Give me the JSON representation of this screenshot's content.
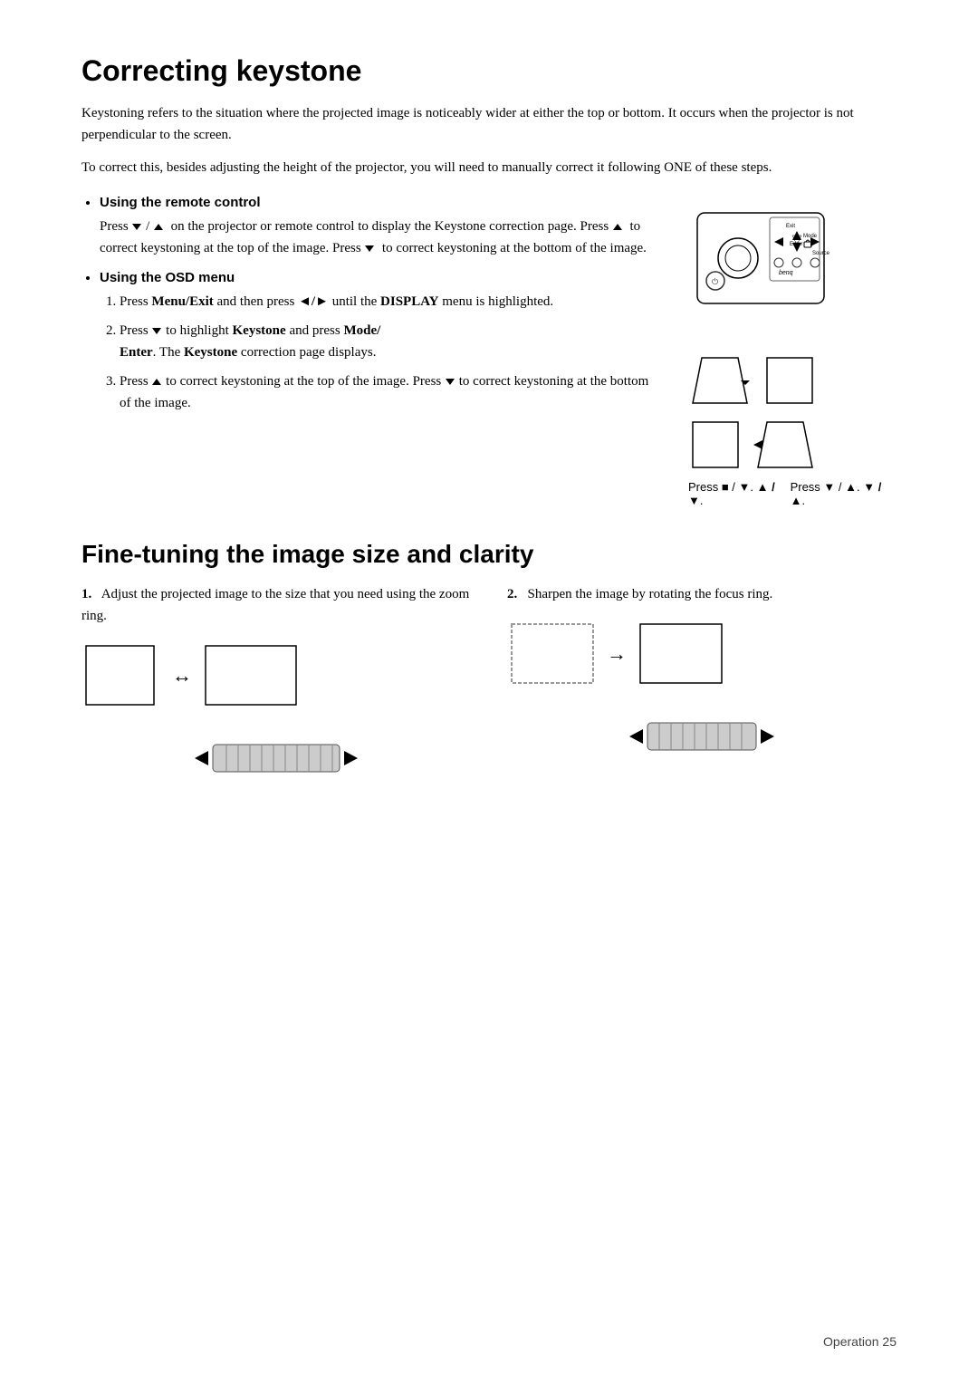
{
  "page": {
    "title": "Correcting keystone",
    "section2_title": "Fine-tuning the image size and clarity",
    "footer": "Operation    25"
  },
  "correcting_keystone": {
    "intro1": "Keystoning refers to the situation where the projected image is noticeably wider at either the top or bottom. It occurs when the projector is not perpendicular to the screen.",
    "intro2": "To correct this, besides adjusting the height of the projector, you will need to manually correct it following ONE of these steps.",
    "bullet1_label": "Using the remote control",
    "bullet1_text1": " /    on the projector or remote control to display the Keystone correction page. Press    to correct keystoning at the top of the image. Press    to correct keystoning at the bottom of the image.",
    "bullet1_press_prefix": "Press",
    "bullet2_label": "Using the OSD menu",
    "step1": "Press Menu/Exit and then press ◄/► until the DISPLAY menu is highlighted.",
    "step2_part1": "Press",
    "step2_part2": "to highlight",
    "step2_keystone": "Keystone",
    "step2_part3": "and press",
    "step2_modeenter": "Mode/Enter",
    "step2_part4": ". The",
    "step2_keystone2": "Keystone",
    "step2_part5": "correction page displays.",
    "step3_part1": "Press",
    "step3_part2": "to correct keystoning at the top of the image. Press",
    "step3_part3": "to correct keystoning at the bottom of the image.",
    "press_label1": "Press ■ / ▼.",
    "press_label2": "Press ▼ / ▲."
  },
  "fine_tuning": {
    "col1_step": "1.",
    "col1_text": "Adjust the projected image to the size that you need using the zoom ring.",
    "col2_step": "2.",
    "col2_text": "Sharpen the image by rotating the focus ring."
  }
}
